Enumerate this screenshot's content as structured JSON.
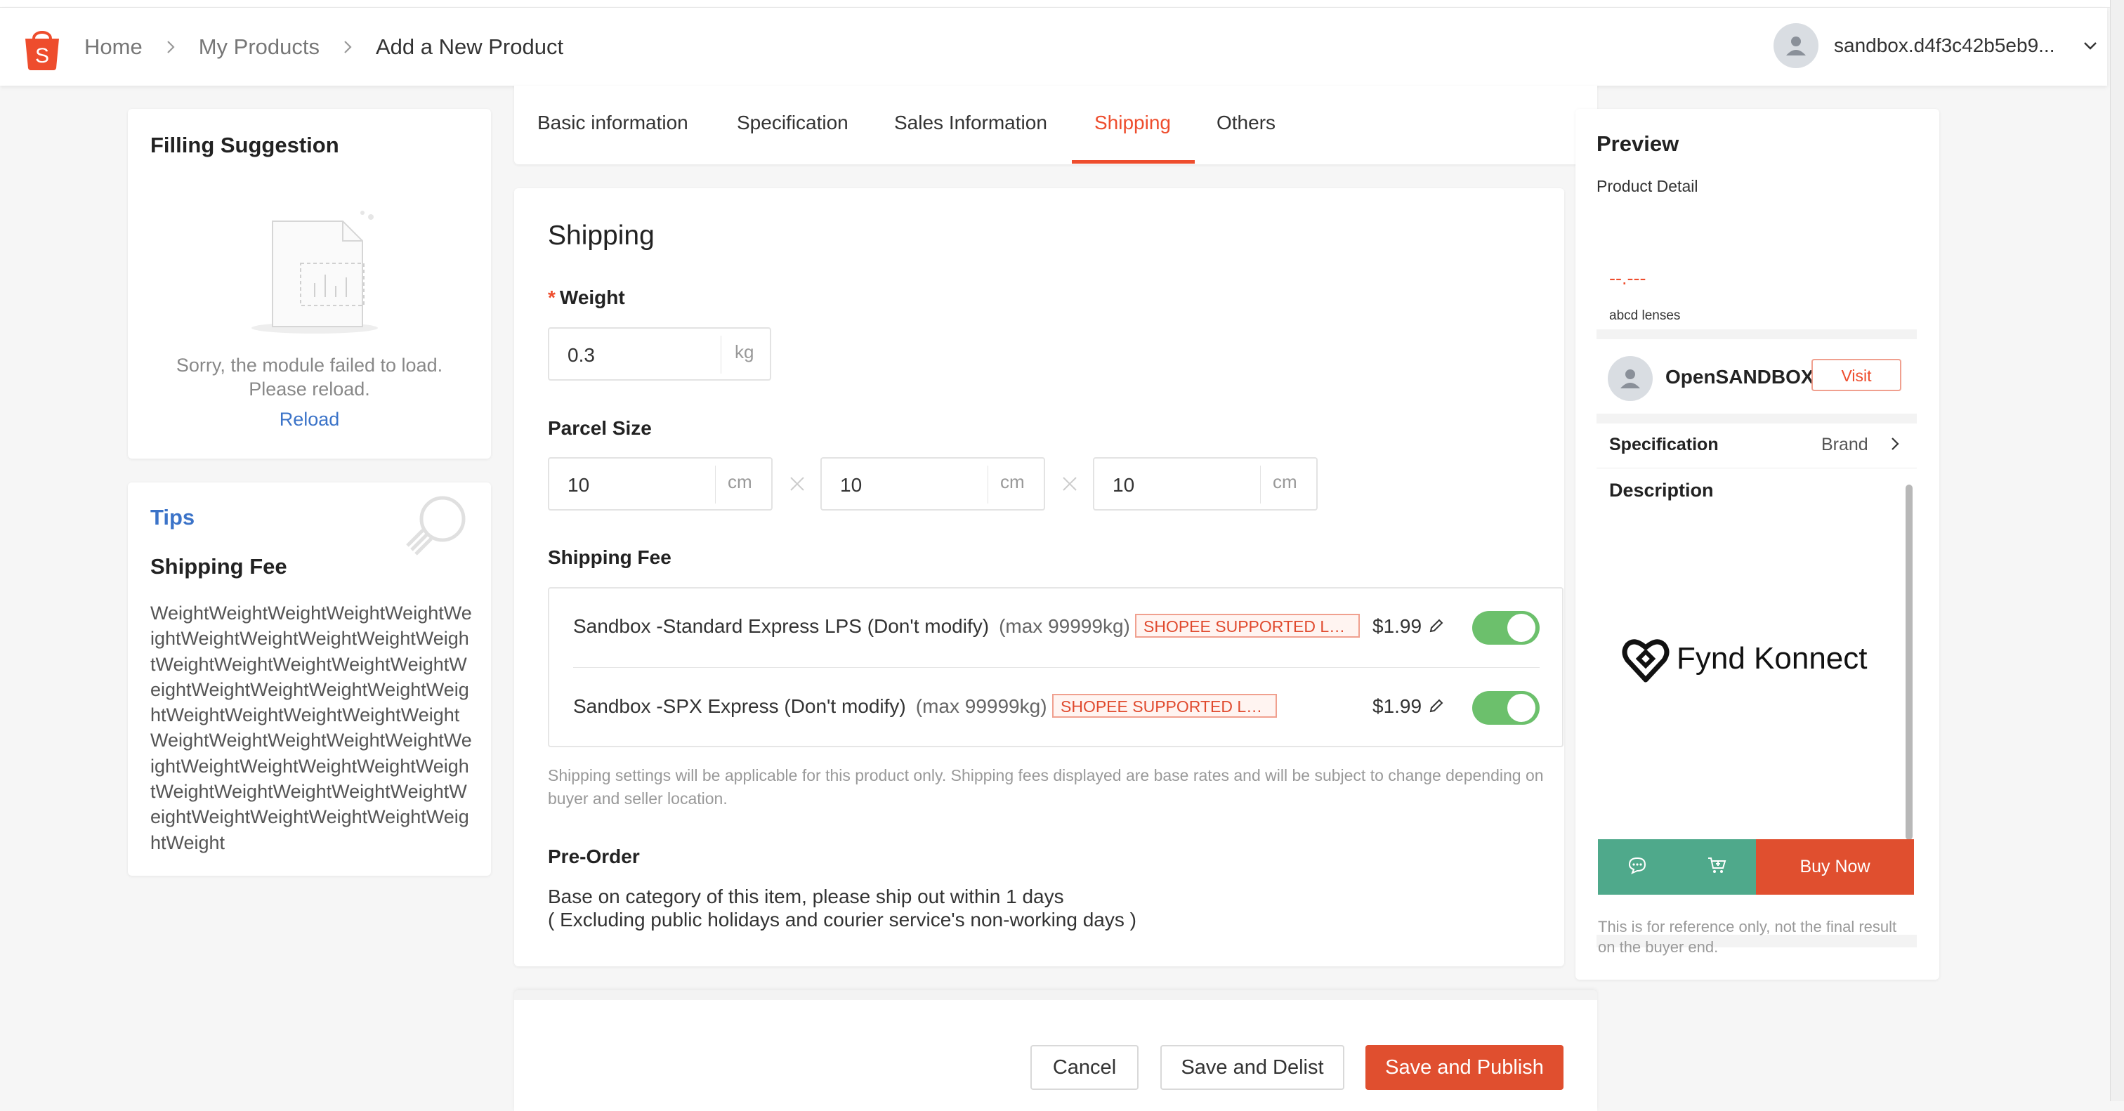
{
  "breadcrumb": {
    "home": "Home",
    "products": "My Products",
    "current": "Add a New Product"
  },
  "user": {
    "name": "sandbox.d4f3c42b5eb9..."
  },
  "filling_suggestion": {
    "title": "Filling Suggestion",
    "message_line1": "Sorry, the module failed to load.",
    "message_line2": "Please reload.",
    "reload_label": "Reload"
  },
  "tips": {
    "title": "Tips",
    "subtitle": "Shipping Fee",
    "body": "WeightWeightWeightWeightWeightWeightWeightWeightWeightWeightWeightWeightWeightWeightWeightWeightWeightWeightWeightWeightWeightWeightWeightWeightWeightWeightWeightWeightWeightWeightWeightWeightWeightWeightWeightWeightWeightWeightWeightWeightWeightWeightWeightWeightWeightWeightWeightWeightWeightWeight"
  },
  "tabs": [
    {
      "label": "Basic information"
    },
    {
      "label": "Specification"
    },
    {
      "label": "Sales Information"
    },
    {
      "label": "Shipping"
    },
    {
      "label": "Others"
    }
  ],
  "active_tab": "Shipping",
  "shipping": {
    "title": "Shipping",
    "weight_label": "Weight",
    "weight_value": "0.3",
    "weight_unit": "kg",
    "parcel_label": "Parcel Size",
    "parcel": [
      {
        "value": "10",
        "unit": "cm"
      },
      {
        "value": "10",
        "unit": "cm"
      },
      {
        "value": "10",
        "unit": "cm"
      }
    ],
    "fee_label": "Shipping Fee",
    "fees": [
      {
        "name": "Sandbox -Standard Express LPS (Don't modify)",
        "max": "(max 99999kg)",
        "tag": "SHOPEE SUPPORTED LOGISTICS",
        "price": "$1.99",
        "enabled": true
      },
      {
        "name": "Sandbox -SPX Express (Don't modify)",
        "max": "(max 99999kg)",
        "tag": "SHOPEE SUPPORTED LOGISTICS",
        "price": "$1.99",
        "enabled": true
      }
    ],
    "note": "Shipping settings will be applicable for this product only. Shipping fees displayed are base rates and will be subject to change depending on buyer and seller location.",
    "preorder_label": "Pre-Order",
    "preorder_line1": "Base on category of this item, please ship out within 1 days",
    "preorder_line2": "( Excluding public holidays and courier service's non-working days )"
  },
  "actions": {
    "cancel": "Cancel",
    "save_delist": "Save and Delist",
    "save_publish": "Save and Publish"
  },
  "preview": {
    "title": "Preview",
    "subtitle": "Product Detail",
    "price": "--.---",
    "product_name": "abcd lenses",
    "shop_name": "OpenSANDBOX",
    "visit_label": "Visit",
    "spec_label": "Specification",
    "spec_value": "Brand",
    "description_label": "Description",
    "logo_text": "Fynd Konnect",
    "buy_now": "Buy Now",
    "footnote": "This is for reference only, not the final result on the buyer end."
  },
  "colors": {
    "brand": "#ee4d2d",
    "toggle_on": "#6cc06c",
    "preview_bar": "#4fa98b",
    "link": "#3b73c8"
  }
}
